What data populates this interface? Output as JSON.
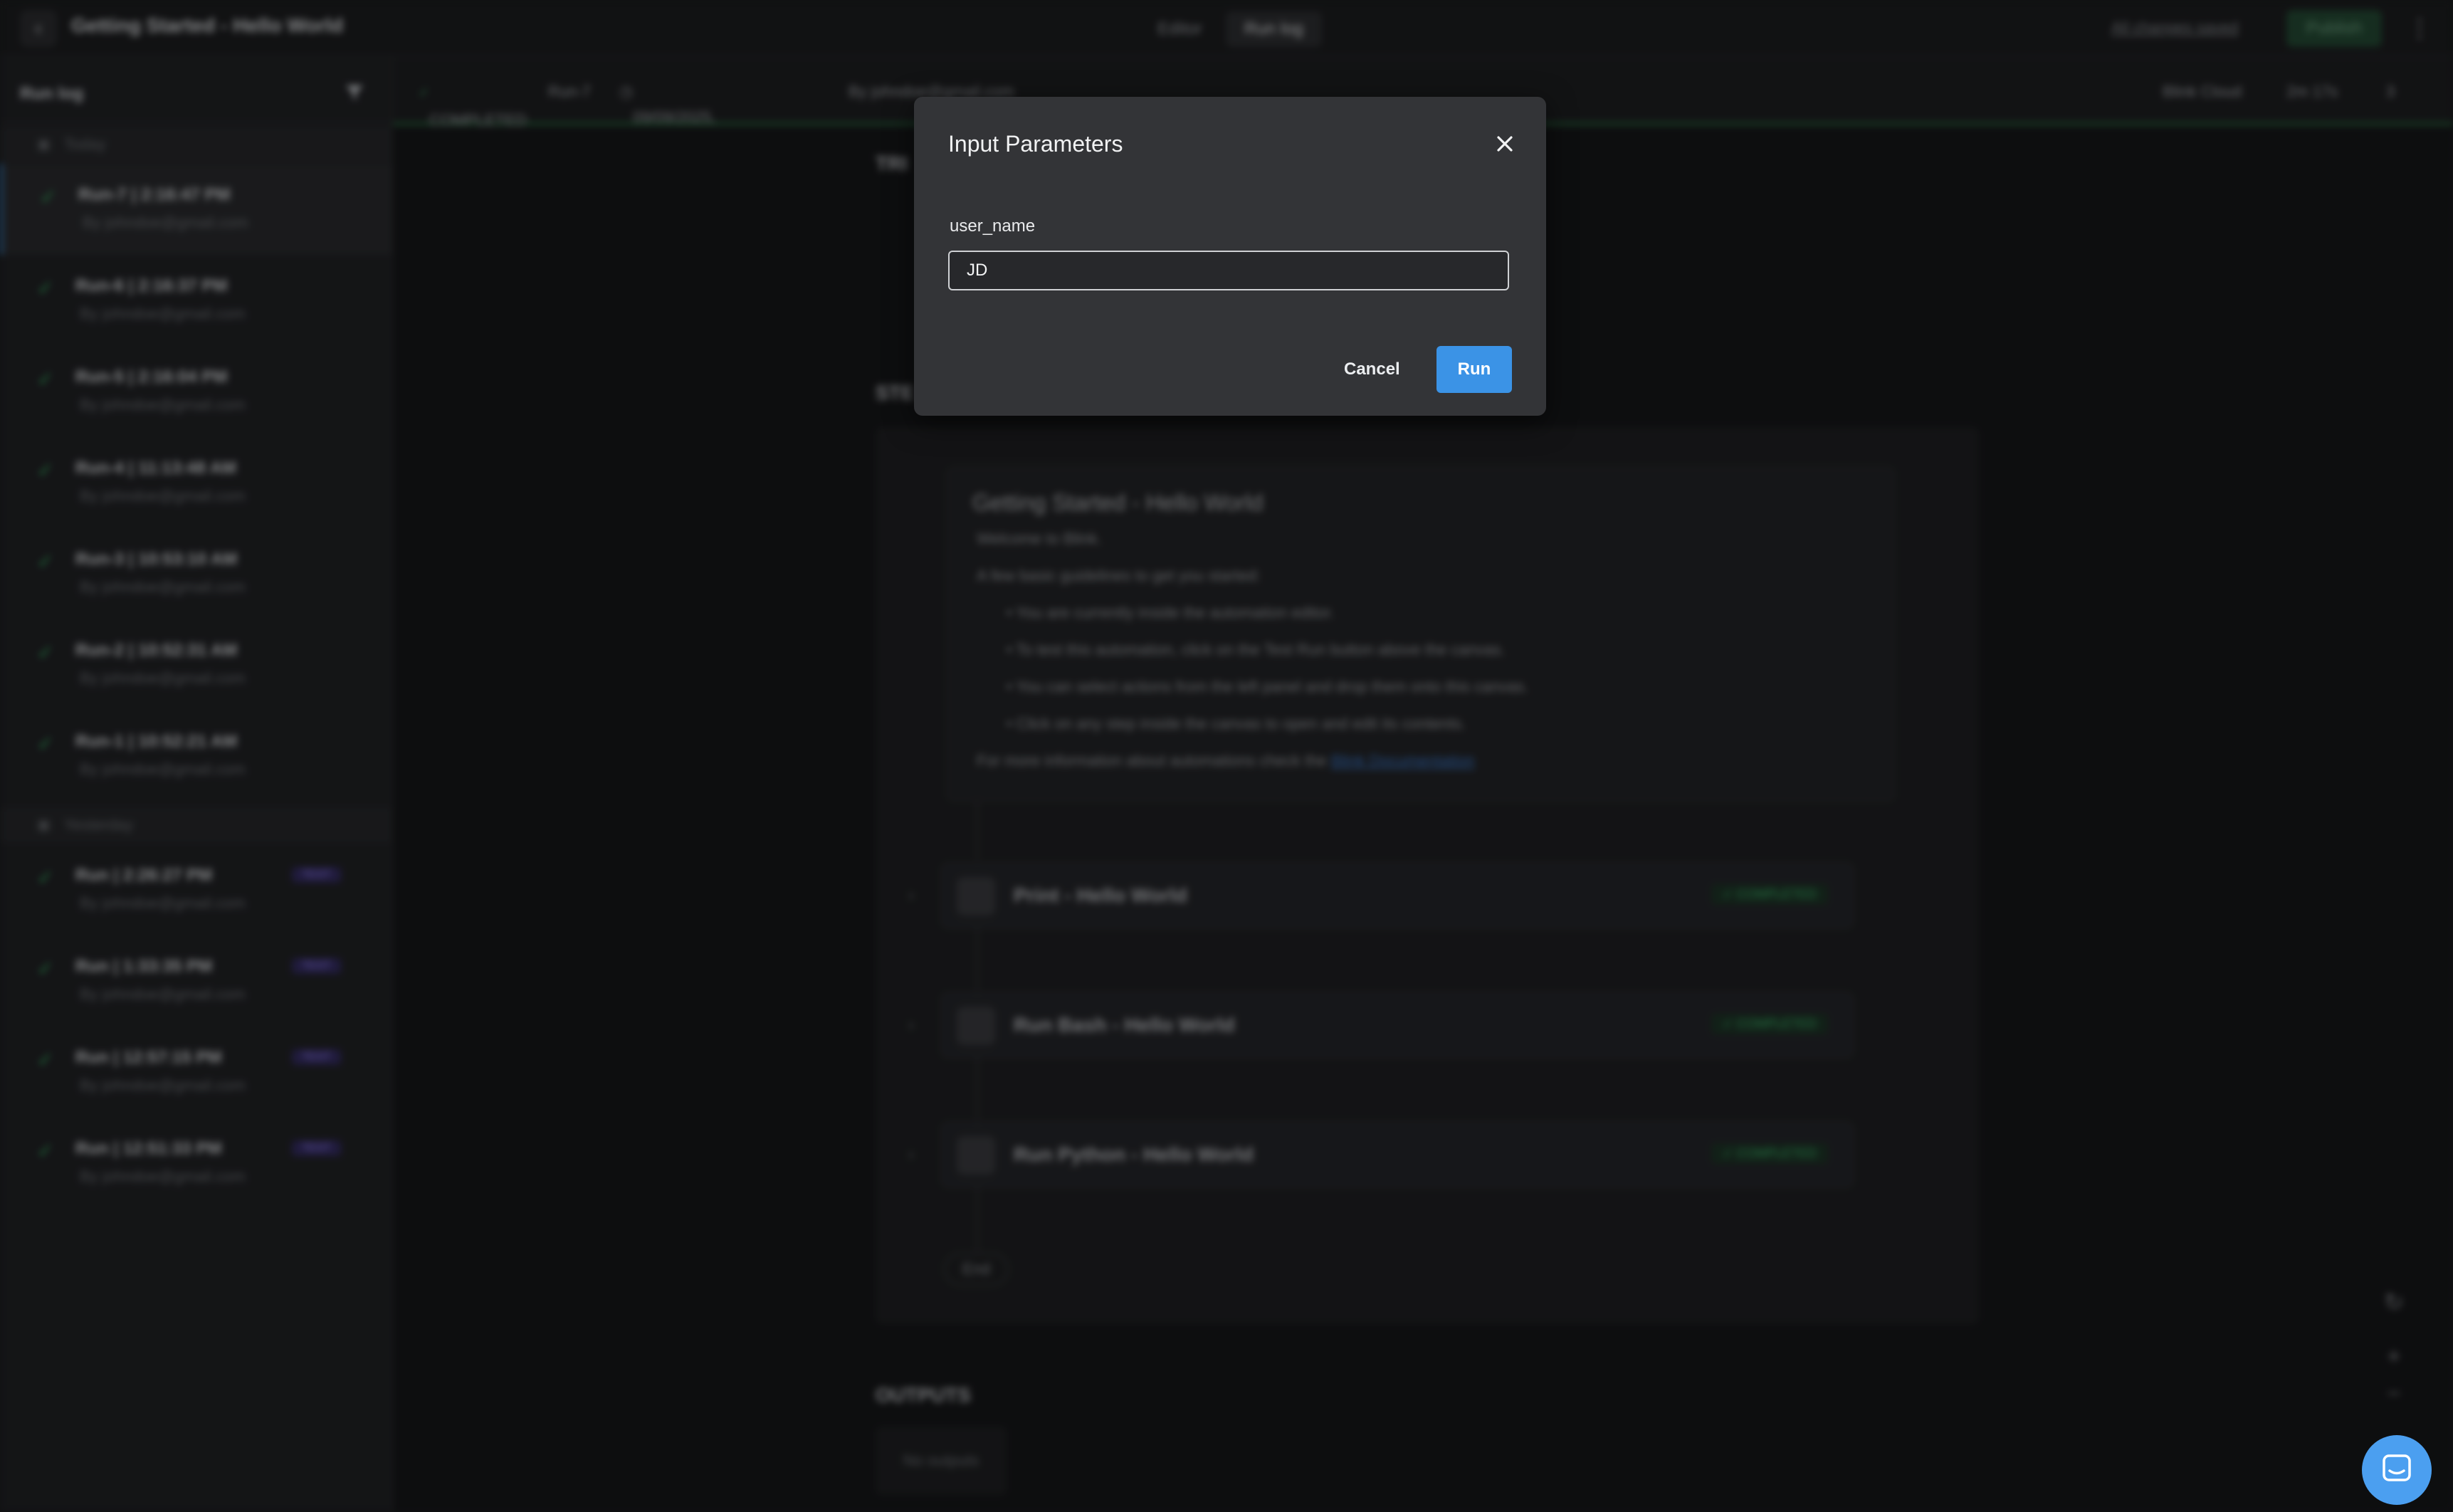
{
  "header": {
    "title": "Getting Started - Hello World",
    "tabs": [
      "Editor",
      "Run log"
    ],
    "saved_status": "All changes saved",
    "publish_label": "Publish"
  },
  "sidebar": {
    "title": "Run log",
    "groups": [
      {
        "label": "Today",
        "runs": [
          {
            "label": "Run-7  |  2:16:47 PM",
            "by": "By johndoe@gmail.com"
          },
          {
            "label": "Run-6  |  2:16:37 PM",
            "by": "By johndoe@gmail.com"
          },
          {
            "label": "Run-5  |  2:16:04 PM",
            "by": "By johndoe@gmail.com"
          },
          {
            "label": "Run-4  |  11:13:48 AM",
            "by": "By johndoe@gmail.com"
          },
          {
            "label": "Run-3  |  10:53:10 AM",
            "by": "By johndoe@gmail.com"
          },
          {
            "label": "Run-2  |  10:52:31 AM",
            "by": "By johndoe@gmail.com"
          },
          {
            "label": "Run-1  |  10:52:21 AM",
            "by": "By johndoe@gmail.com"
          }
        ]
      },
      {
        "label": "Yesterday",
        "runs": [
          {
            "label": "Run  |  2:26:27 PM",
            "by": "By johndoe@gmail.com",
            "badge": "TEST"
          },
          {
            "label": "Run  |  1:33:35 PM",
            "by": "By johndoe@gmail.com",
            "badge": "TEST"
          },
          {
            "label": "Run  |  12:57:15 PM",
            "by": "By johndoe@gmail.com",
            "badge": "TEST"
          },
          {
            "label": "Run  |  12:51:33 PM",
            "by": "By johndoe@gmail.com",
            "badge": "TEST"
          }
        ]
      }
    ]
  },
  "runbar": {
    "status": "COMPLETED",
    "run": "Run-7",
    "datetime": "09/09/2025, 2:16:47 PM",
    "by": "By johndoe@gmail.com",
    "env": "Blink Cloud",
    "duration": "2m 17s",
    "ok_count": "3"
  },
  "canvas": {
    "trigger_label": "TRI",
    "steps_label": "STE",
    "note": {
      "title": "Getting Started - Hello World",
      "welcome": "Welcome to Blink.",
      "intro": "A few basic guidelines to get you started:",
      "bullets": [
        "You are currently inside the automation editor.",
        "To test this automation, click on the Test Run button above the canvas.",
        "You can select actions from the left panel and drop them onto this canvas.",
        "Click on any step inside the canvas to open and edit its contents."
      ],
      "more_info": "For more information about automations check the ",
      "link": "Blink Documentation"
    },
    "steps": [
      {
        "name": "Print - Hello World",
        "status": "COMPLETED"
      },
      {
        "name": "Run Bash - Hello World",
        "status": "COMPLETED"
      },
      {
        "name": "Run Python - Hello World",
        "status": "COMPLETED"
      }
    ],
    "end_label": "End",
    "outputs_label": "OUTPUTS",
    "no_outputs": "No outputs"
  },
  "modal": {
    "title": "Input Parameters",
    "field_label": "user_name",
    "field_value": "JD",
    "cancel_label": "Cancel",
    "run_label": "Run"
  },
  "colors": {
    "accent": "#3b93e6",
    "success": "#38b863",
    "modal_bg": "#333437"
  }
}
